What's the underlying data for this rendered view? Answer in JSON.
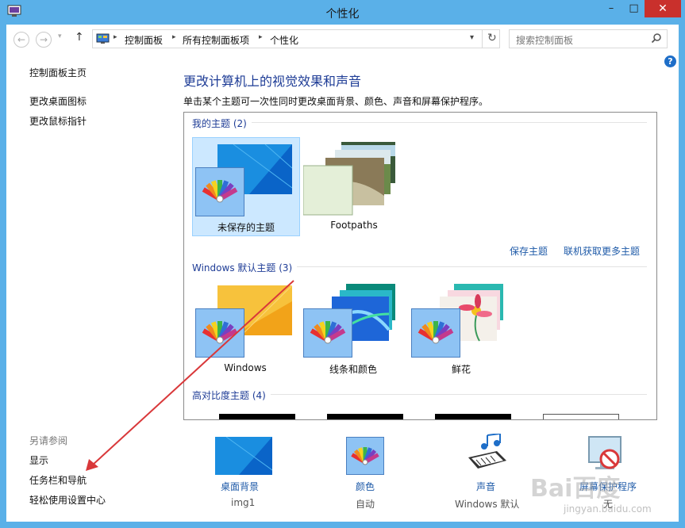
{
  "window": {
    "title": "个性化",
    "minimize": "–",
    "maximize": "□",
    "close": "✕"
  },
  "nav": {
    "back": "←",
    "forward": "→",
    "dropdown": "▾",
    "up": "↑"
  },
  "address": {
    "crumbs": [
      "控制面板",
      "所有控制面板项",
      "个性化"
    ],
    "separator": "▸",
    "dropdown": "▾",
    "refresh": "↻"
  },
  "search": {
    "placeholder": "搜索控制面板"
  },
  "help": "?",
  "sidebar": {
    "items": [
      "控制面板主页",
      "更改桌面图标",
      "更改鼠标指针"
    ],
    "see_also_caption": "另请参阅",
    "see_also": [
      "显示",
      "任务栏和导航",
      "轻松使用设置中心"
    ]
  },
  "main": {
    "heading": "更改计算机上的视觉效果和声音",
    "subtitle": "单击某个主题可一次性同时更改桌面背景、颜色、声音和屏幕保护程序。"
  },
  "themes": {
    "my_themes": {
      "title": "我的主题 (2)",
      "items": [
        "未保存的主题",
        "Footpaths"
      ],
      "save_link": "保存主题",
      "online_link": "联机获取更多主题"
    },
    "windows_defaults": {
      "title": "Windows 默认主题 (3)",
      "items": [
        "Windows",
        "线条和颜色",
        "鲜花"
      ]
    },
    "high_contrast": {
      "title": "高对比度主题 (4)"
    }
  },
  "bottom": {
    "items": [
      {
        "label": "桌面背景",
        "value": "img1"
      },
      {
        "label": "颜色",
        "value": "自动"
      },
      {
        "label": "声音",
        "value": "Windows 默认"
      },
      {
        "label": "屏幕保护程序",
        "value": "无"
      }
    ]
  },
  "watermark": {
    "main": "Bai百度",
    "sub": "jingyan.baidu.com"
  },
  "colors": {
    "accent": "#5ab0e8",
    "link": "#1e5aa8",
    "heading": "#1e3c96",
    "selection": "#cce8ff",
    "arrow": "#d9383a"
  }
}
